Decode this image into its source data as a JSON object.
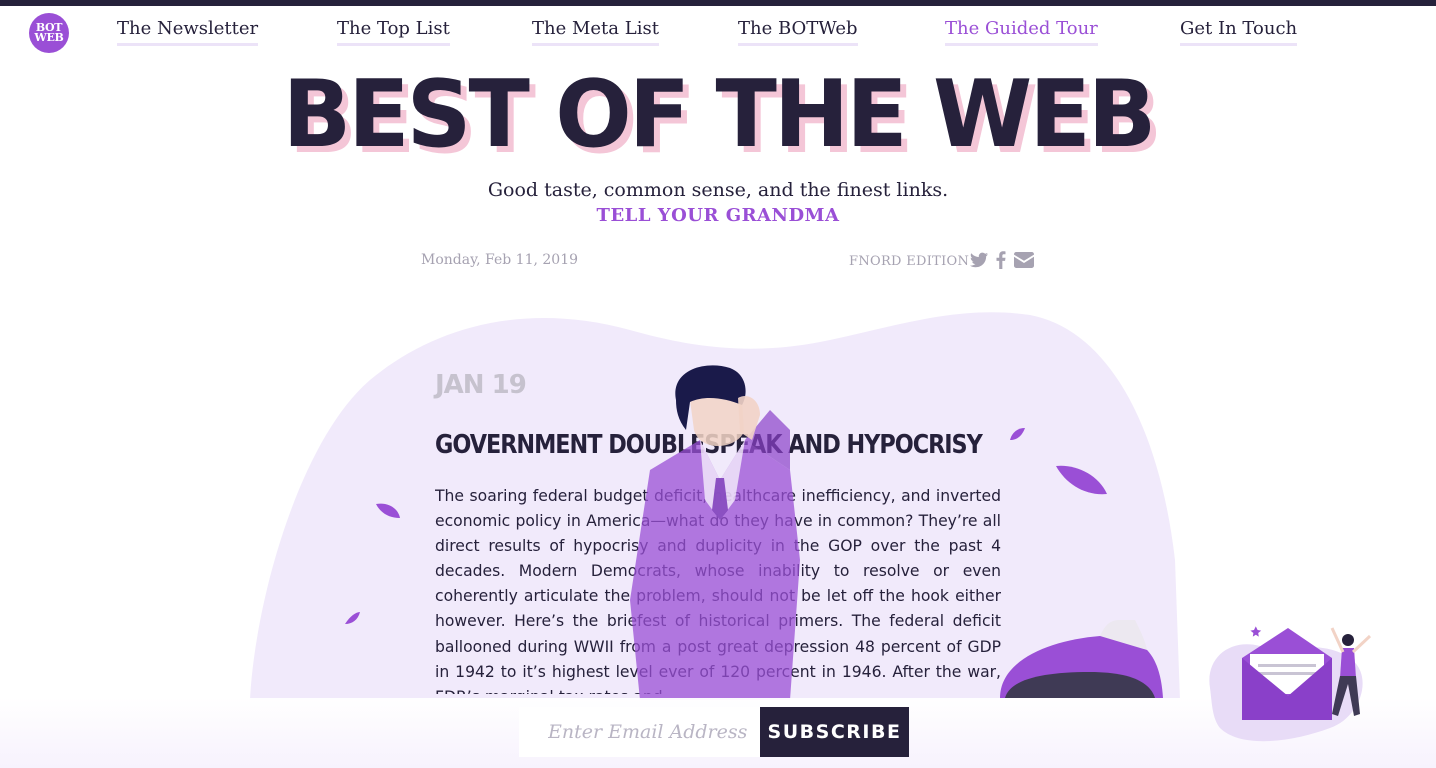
{
  "logo": {
    "line1": "BOT",
    "line2": "WEB"
  },
  "nav": [
    {
      "label": "The Newsletter",
      "active": false
    },
    {
      "label": "The Top List",
      "active": false
    },
    {
      "label": "The Meta List",
      "active": false
    },
    {
      "label": "The BOTWeb",
      "active": false
    },
    {
      "label": "The Guided Tour",
      "active": true
    },
    {
      "label": "Get In Touch",
      "active": false
    }
  ],
  "hero": {
    "title": "BEST OF THE WEB",
    "tagline": "Good taste, common sense, and the finest links.",
    "cta": "TELL YOUR GRANDMA"
  },
  "meta": {
    "date": "Monday, Feb 11, 2019",
    "edition": "FNORD EDITION",
    "share_icons": [
      "twitter-icon",
      "facebook-icon",
      "email-icon"
    ]
  },
  "article": {
    "date": "JAN 19",
    "title": "Government Doublespeak and Hypocrisy",
    "body": "The soaring federal budget deficit, healthcare inefficiency, and inverted economic policy in America—what do they have in common? They’re all direct results of hypocrisy and duplicity in the GOP over the past 4 decades. Modern Democrats, whose inability to resolve or even coherently articulate the problem, should not be let off the hook either however. Here’s the briefest of historical primers. The federal deficit ballooned during WWII from a post great depression 48 percent of GDP in 1942 to it’s highest level ever of 120 percent in 1946. After the war, FDR’s marginal tax rates and..."
  },
  "subscribe": {
    "placeholder": "Enter Email Address",
    "button": "SUBSCRIBE"
  },
  "colors": {
    "accent": "#9a4fd6",
    "dark": "#26213b",
    "muted": "#a6a2b1",
    "blob": "#f1eafb",
    "title_shadow": "#f4c6d7"
  }
}
